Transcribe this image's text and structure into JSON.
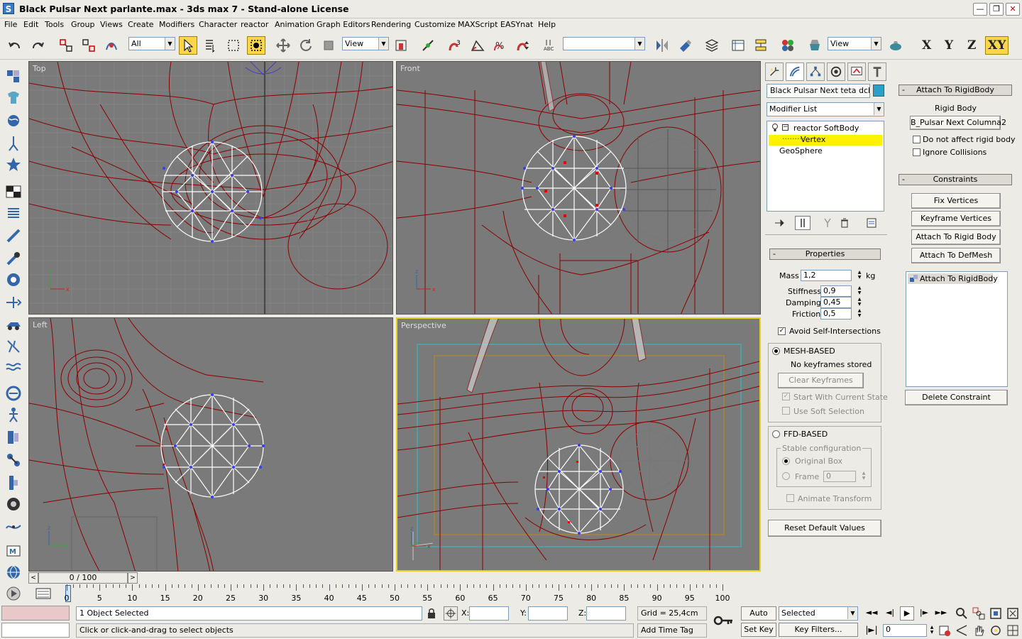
{
  "window": {
    "title": "Black Pulsar Next parlante.max - 3ds max 7  - Stand-alone License"
  },
  "menu": [
    "File",
    "Edit",
    "Tools",
    "Group",
    "Views",
    "Create",
    "Modifiers",
    "Character",
    "reactor",
    "Animation",
    "Graph Editors",
    "Rendering",
    "Customize",
    "MAXScript",
    "EASYnat",
    "Help"
  ],
  "toolbar": {
    "selection_filter": "All",
    "ref_coord": "View",
    "named_sel": "",
    "view2": "View",
    "axis": [
      "X",
      "Y",
      "Z",
      "XY"
    ]
  },
  "viewports": {
    "top": "Top",
    "front": "Front",
    "left": "Left",
    "perspective": "Perspective"
  },
  "command_panel": {
    "object_name": "Black Pulsar Next teta dcha",
    "object_color": "#2aa1c8",
    "modifier_list": "Modifier List",
    "stack": [
      {
        "label": "reactor SoftBody",
        "level": 0
      },
      {
        "label": "Vertex",
        "level": 1,
        "selected": true
      },
      {
        "label": "GeoSphere",
        "level": 0
      }
    ],
    "properties": {
      "header": "Properties",
      "mass_label": "Mass",
      "mass": "1,2",
      "mass_unit": "kg",
      "stiffness_label": "Stiffness",
      "stiffness": "0,9",
      "damping_label": "Damping",
      "damping": "0,45",
      "friction_label": "Friction",
      "friction": "0,5",
      "avoid_self": "Avoid Self-Intersections",
      "avoid_self_checked": true
    },
    "mesh_based": {
      "label": "MESH-BASED",
      "status": "No keyframes stored",
      "clear_btn": "Clear Keyframes",
      "start_current": "Start With Current State",
      "use_soft": "Use Soft Selection"
    },
    "ffd_based": {
      "label": "FFD-BASED",
      "stable_config": "Stable configuration",
      "original_box": "Original Box",
      "frame": "Frame",
      "frame_value": "0",
      "animate_transform": "Animate Transform"
    },
    "reset_btn": "Reset Default Values",
    "attach_rollout": {
      "header": "Attach To RigidBody",
      "rigid_body_label": "Rigid Body",
      "rigid_body_value": "B_Pulsar Next Columna2",
      "do_not_affect": "Do not affect rigid body",
      "ignore_collisions": "Ignore Collisions"
    },
    "constraints": {
      "header": "Constraints",
      "buttons": [
        "Fix Vertices",
        "Keyframe Vertices",
        "Attach To Rigid Body",
        "Attach To DefMesh"
      ],
      "list": [
        "Attach To RigidBody"
      ],
      "delete_btn": "Delete Constraint"
    }
  },
  "timeline": {
    "slider": "0 / 100",
    "ticks": [
      "0",
      "5",
      "10",
      "15",
      "20",
      "25",
      "30",
      "35",
      "40",
      "45",
      "50",
      "55",
      "60",
      "65",
      "70",
      "75",
      "80",
      "85",
      "90",
      "95",
      "100"
    ]
  },
  "status": {
    "selected": "1 Object Selected",
    "prompt": "Click or click-and-drag to select objects",
    "x_label": "X:",
    "y_label": "Y:",
    "z_label": "Z:",
    "grid": "Grid = 25,4cm",
    "add_time_tag": "Add Time Tag",
    "auto_key": "Auto Key",
    "set_key": "Set Key",
    "key_mode": "Selected",
    "key_filters": "Key Filters...",
    "frame": "0"
  }
}
